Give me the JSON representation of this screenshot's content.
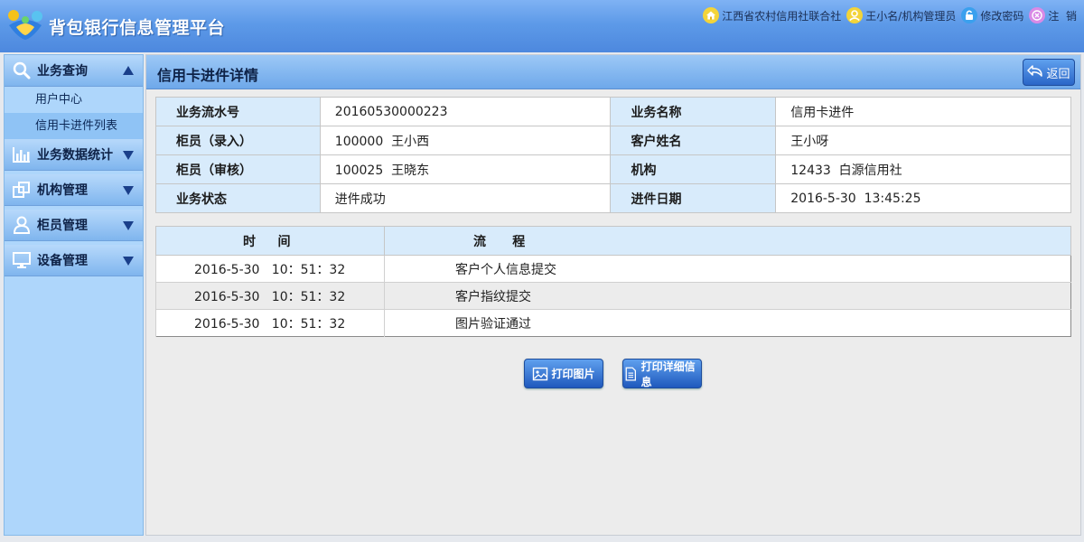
{
  "header": {
    "app_title": "背包银行信息管理平台",
    "nav": {
      "org": "江西省农村信用社联合社",
      "user": "王小名/机构管理员",
      "change_password": "修改密码",
      "logout": "注  销"
    }
  },
  "sidebar": {
    "groups": [
      {
        "label": "业务查询",
        "icon": "search-icon",
        "expanded": true,
        "items": [
          {
            "label": "用户中心"
          },
          {
            "label": "信用卡进件列表",
            "active": true
          }
        ]
      },
      {
        "label": "业务数据统计",
        "icon": "bar-chart-icon",
        "expanded": false
      },
      {
        "label": "机构管理",
        "icon": "windows-icon",
        "expanded": false
      },
      {
        "label": "柜员管理",
        "icon": "user-icon",
        "expanded": false
      },
      {
        "label": "设备管理",
        "icon": "monitor-icon",
        "expanded": false
      }
    ]
  },
  "main": {
    "title": "信用卡进件详情",
    "back_label": "返回",
    "info": {
      "rows": [
        {
          "l1": "业务流水号",
          "v1": "20160530000223",
          "l2": "业务名称",
          "v2": "信用卡进件"
        },
        {
          "l1": "柜员（录入）",
          "v1": "100000  王小西",
          "l2": "客户姓名",
          "v2": "王小呀"
        },
        {
          "l1": "柜员（审核）",
          "v1": "100025  王晓东",
          "l2": "机构",
          "v2": "12433  白源信用社"
        },
        {
          "l1": "业务状态",
          "v1": "进件成功",
          "l2": "进件日期",
          "v2": "2016-5-30  13:45:25"
        }
      ]
    },
    "process": {
      "headers": {
        "time": "时    间",
        "flow": "流      程"
      },
      "rows": [
        {
          "time": "2016-5-30   10：51：32",
          "flow": "客户个人信息提交"
        },
        {
          "time": "2016-5-30   10：51：32",
          "flow": "客户指纹提交"
        },
        {
          "time": "2016-5-30   10：51：32",
          "flow": "图片验证通过"
        }
      ]
    },
    "actions": {
      "print_image": "打印图片",
      "print_detail": "打印详细信息"
    }
  },
  "colors": {
    "header_blue": "#5d9ae8",
    "sidebar_bg": "#aed6fb",
    "label_cell_bg": "#d8ebfb",
    "button_blue": "#2a66c8"
  }
}
